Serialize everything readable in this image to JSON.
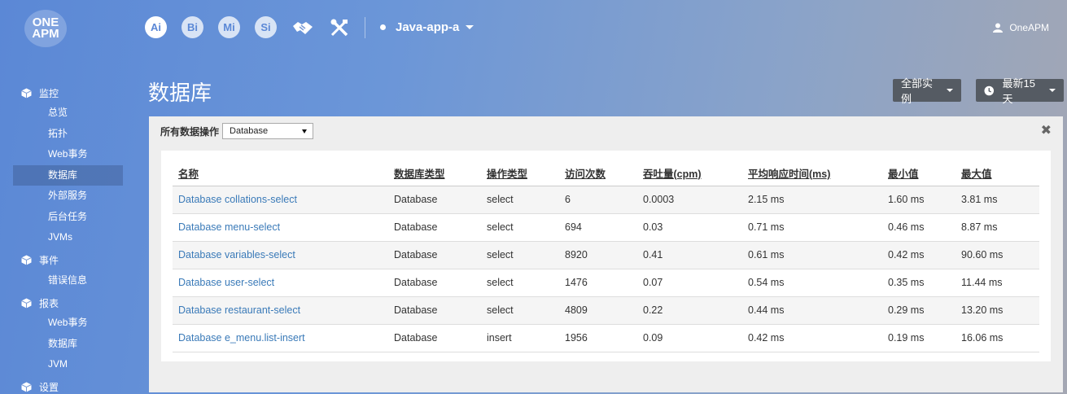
{
  "header": {
    "logo_line1": "ONE",
    "logo_line2": "APM",
    "products": [
      "Ai",
      "Bi",
      "Mi",
      "Si"
    ],
    "app_name": "Java-app-a",
    "user_name": "OneAPM"
  },
  "sidebar": {
    "sections": [
      {
        "label": "监控",
        "icon": "cube-icon",
        "items": [
          "总览",
          "拓扑",
          "Web事务",
          "数据库",
          "外部服务",
          "后台任务",
          "JVMs"
        ]
      },
      {
        "label": "事件",
        "icon": "cube-icon",
        "items": [
          "错误信息"
        ]
      },
      {
        "label": "报表",
        "icon": "cube-icon",
        "items": [
          "Web事务",
          "数据库",
          "JVM"
        ]
      },
      {
        "label": "设置",
        "icon": "cube-icon",
        "items": []
      }
    ],
    "active_item": "数据库"
  },
  "page": {
    "title": "数据库",
    "instances_button": "全部实例",
    "time_button": "最新15天",
    "filter_label": "所有数据操作",
    "filter_value": "Database",
    "close": "✖"
  },
  "table": {
    "columns": [
      "名称",
      "数据库类型",
      "操作类型",
      "访问次数",
      "吞吐量(cpm)",
      "平均响应时间(ms)",
      "最小值",
      "最大值"
    ],
    "rows": [
      [
        "Database collations-select",
        "Database",
        "select",
        "6",
        "0.0003",
        "2.15 ms",
        "1.60 ms",
        "3.81 ms"
      ],
      [
        "Database menu-select",
        "Database",
        "select",
        "694",
        "0.03",
        "0.71 ms",
        "0.46 ms",
        "8.87 ms"
      ],
      [
        "Database variables-select",
        "Database",
        "select",
        "8920",
        "0.41",
        "0.61 ms",
        "0.42 ms",
        "90.60 ms"
      ],
      [
        "Database user-select",
        "Database",
        "select",
        "1476",
        "0.07",
        "0.54 ms",
        "0.35 ms",
        "11.44 ms"
      ],
      [
        "Database restaurant-select",
        "Database",
        "select",
        "4809",
        "0.22",
        "0.44 ms",
        "0.29 ms",
        "13.20 ms"
      ],
      [
        "Database e_menu.list-insert",
        "Database",
        "insert",
        "1956",
        "0.09",
        "0.42 ms",
        "0.19 ms",
        "16.06 ms"
      ]
    ]
  }
}
